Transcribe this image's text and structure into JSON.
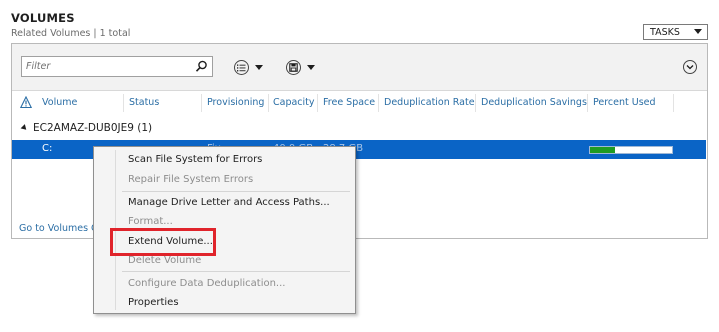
{
  "section": {
    "title": "VOLUMES",
    "subtitle": "Related Volumes | 1 total",
    "tasks_label": "TASKS"
  },
  "toolbar": {
    "filter_placeholder": "Filter",
    "icons": [
      "search-icon",
      "list-view-icon",
      "save-query-icon",
      "collapse-icon"
    ]
  },
  "columns": [
    "Volume",
    "Status",
    "Provisioning",
    "Capacity",
    "Free Space",
    "Deduplication Rate",
    "Deduplication Savings",
    "Percent Used"
  ],
  "group": {
    "label": "EC2AMAZ-DUB0JE9 (1)"
  },
  "rows": [
    {
      "volume": "C:",
      "provisioning_fragment": "Fix...",
      "capacity_fragment": "40.0 GB",
      "free_space_fragment": "28.7 GB",
      "percent_used": 30,
      "selected": true
    }
  ],
  "footer": {
    "link_label": "Go to Volumes Overview"
  },
  "context_menu": {
    "items": [
      {
        "label": "Scan File System for Errors",
        "enabled": true
      },
      {
        "label": "Repair File System Errors",
        "enabled": false
      },
      {
        "label": "Manage Drive Letter and Access Paths...",
        "enabled": true
      },
      {
        "label": "Format...",
        "enabled": false
      },
      {
        "label": "Extend Volume...",
        "enabled": true,
        "highlighted": true
      },
      {
        "label": "Delete Volume",
        "enabled": false
      },
      {
        "label": "Configure Data Deduplication...",
        "enabled": false
      },
      {
        "label": "Properties",
        "enabled": true
      }
    ]
  },
  "colors": {
    "selection": "#0a64c6",
    "link": "#2b6ea5",
    "progress": "#1f9b23",
    "highlight": "#e0242b"
  }
}
